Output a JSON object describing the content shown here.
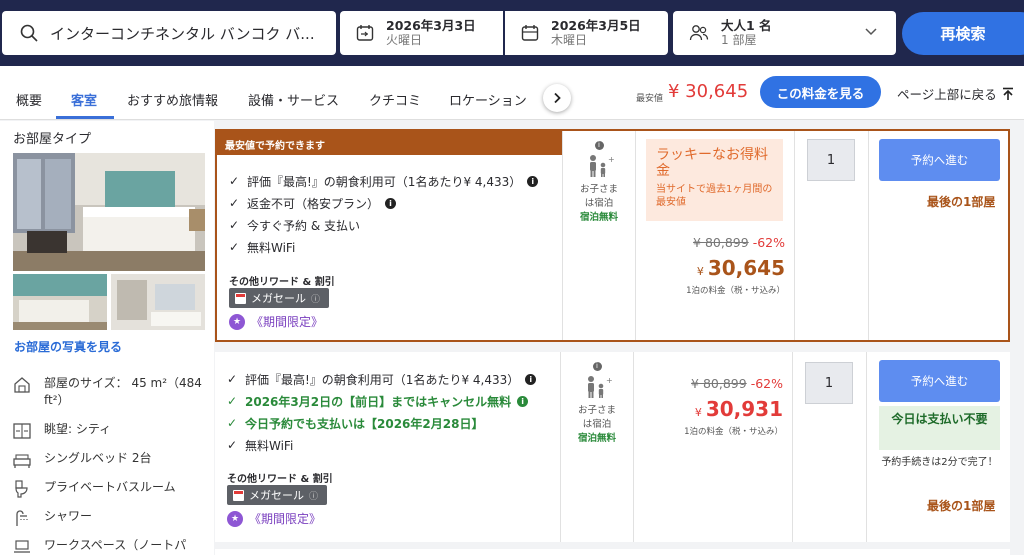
{
  "search": {
    "destination": "インターコンチネンタル バンコク バ...",
    "checkin": {
      "date": "2026年3月3日",
      "weekday": "火曜日"
    },
    "checkout": {
      "date": "2026年3月5日",
      "weekday": "木曜日"
    },
    "guests": {
      "adults": "大人1 名",
      "rooms": "1 部屋"
    },
    "research_label": "再検索"
  },
  "nav": {
    "tabs": [
      "概要",
      "客室",
      "おすすめ旅情報",
      "設備・サービス",
      "クチコミ",
      "ロケーション"
    ],
    "active_tab": "客室",
    "lowest_label": "最安値",
    "lowest_price": "¥ 30,645",
    "see_rate_label": "この料金を見る",
    "back_to_top": "ページ上部に戻る"
  },
  "room": {
    "type_label": "お部屋タイプ",
    "see_photos": "お部屋の写真を見る",
    "features": [
      {
        "icon": "room-size-icon",
        "text": "部屋のサイズ： 45 m²（484 ft²）"
      },
      {
        "icon": "view-icon",
        "text": "眺望: シティ"
      },
      {
        "icon": "bed-icon",
        "text": "シングルベッド 2台"
      },
      {
        "icon": "toilet-icon",
        "text": "プライベートバスルーム"
      },
      {
        "icon": "shower-icon",
        "text": "シャワー"
      },
      {
        "icon": "workspace-icon",
        "text": "ワークスペース（ノートパ"
      }
    ]
  },
  "offers": [
    {
      "badge": "最安値で予約できます",
      "benefits": [
        {
          "text": "評価『最高!』の朝食利用可（1名あたり¥ 4,433）",
          "green": false,
          "info": true
        },
        {
          "text": "返金不可（格安プラン）",
          "green": false,
          "info": true
        },
        {
          "text": "今すぐ予約 & 支払い",
          "green": false,
          "info": false
        },
        {
          "text": "無料WiFi",
          "green": false,
          "info": false
        }
      ],
      "rewards_label": "その他リワード & 割引",
      "megasale": "メガセール",
      "limited": "《期間限定》",
      "child": {
        "line1": "お子さま",
        "line2": "は宿泊",
        "free": "宿泊無料"
      },
      "lucky_title": "ラッキーなお得料金",
      "lucky_sub": "当サイトで過去1ヶ月間の最安値",
      "old_price": "¥ 80,899",
      "discount": "-62%",
      "yen": "¥",
      "price": "30,645",
      "per_night": "1泊の料金（税・サ込み）",
      "qty": "1",
      "reserve_label": "予約へ進む",
      "last_room": "最後の1部屋"
    },
    {
      "benefits": [
        {
          "text": "評価『最高!』の朝食利用可（1名あたり¥ 4,433）",
          "green": false,
          "info": true
        },
        {
          "text": "2026年3月2日の【前日】まではキャンセル無料",
          "green": true,
          "info": true
        },
        {
          "text": "今日予約でも支払いは【2026年2月28日】",
          "green": true,
          "info": false
        },
        {
          "text": "無料WiFi",
          "green": false,
          "info": false
        }
      ],
      "rewards_label": "その他リワード & 割引",
      "megasale": "メガセール",
      "limited": "《期間限定》",
      "child": {
        "line1": "お子さま",
        "line2": "は宿泊",
        "free": "宿泊無料"
      },
      "old_price": "¥ 80,899",
      "discount": "-62%",
      "yen": "¥",
      "price": "30,931",
      "per_night": "1泊の料金（税・サ込み）",
      "qty": "1",
      "reserve_label": "予約へ進む",
      "pay_today": "今日は支払い不要",
      "two_min": "予約手続きは2分で完了！",
      "last_room": "最後の1部屋"
    }
  ],
  "colors": {
    "navy": "#20274d",
    "primary": "#3072e3",
    "brand_brown": "#a9541a",
    "price_red": "#e23b39",
    "green": "#2a8a3a"
  }
}
